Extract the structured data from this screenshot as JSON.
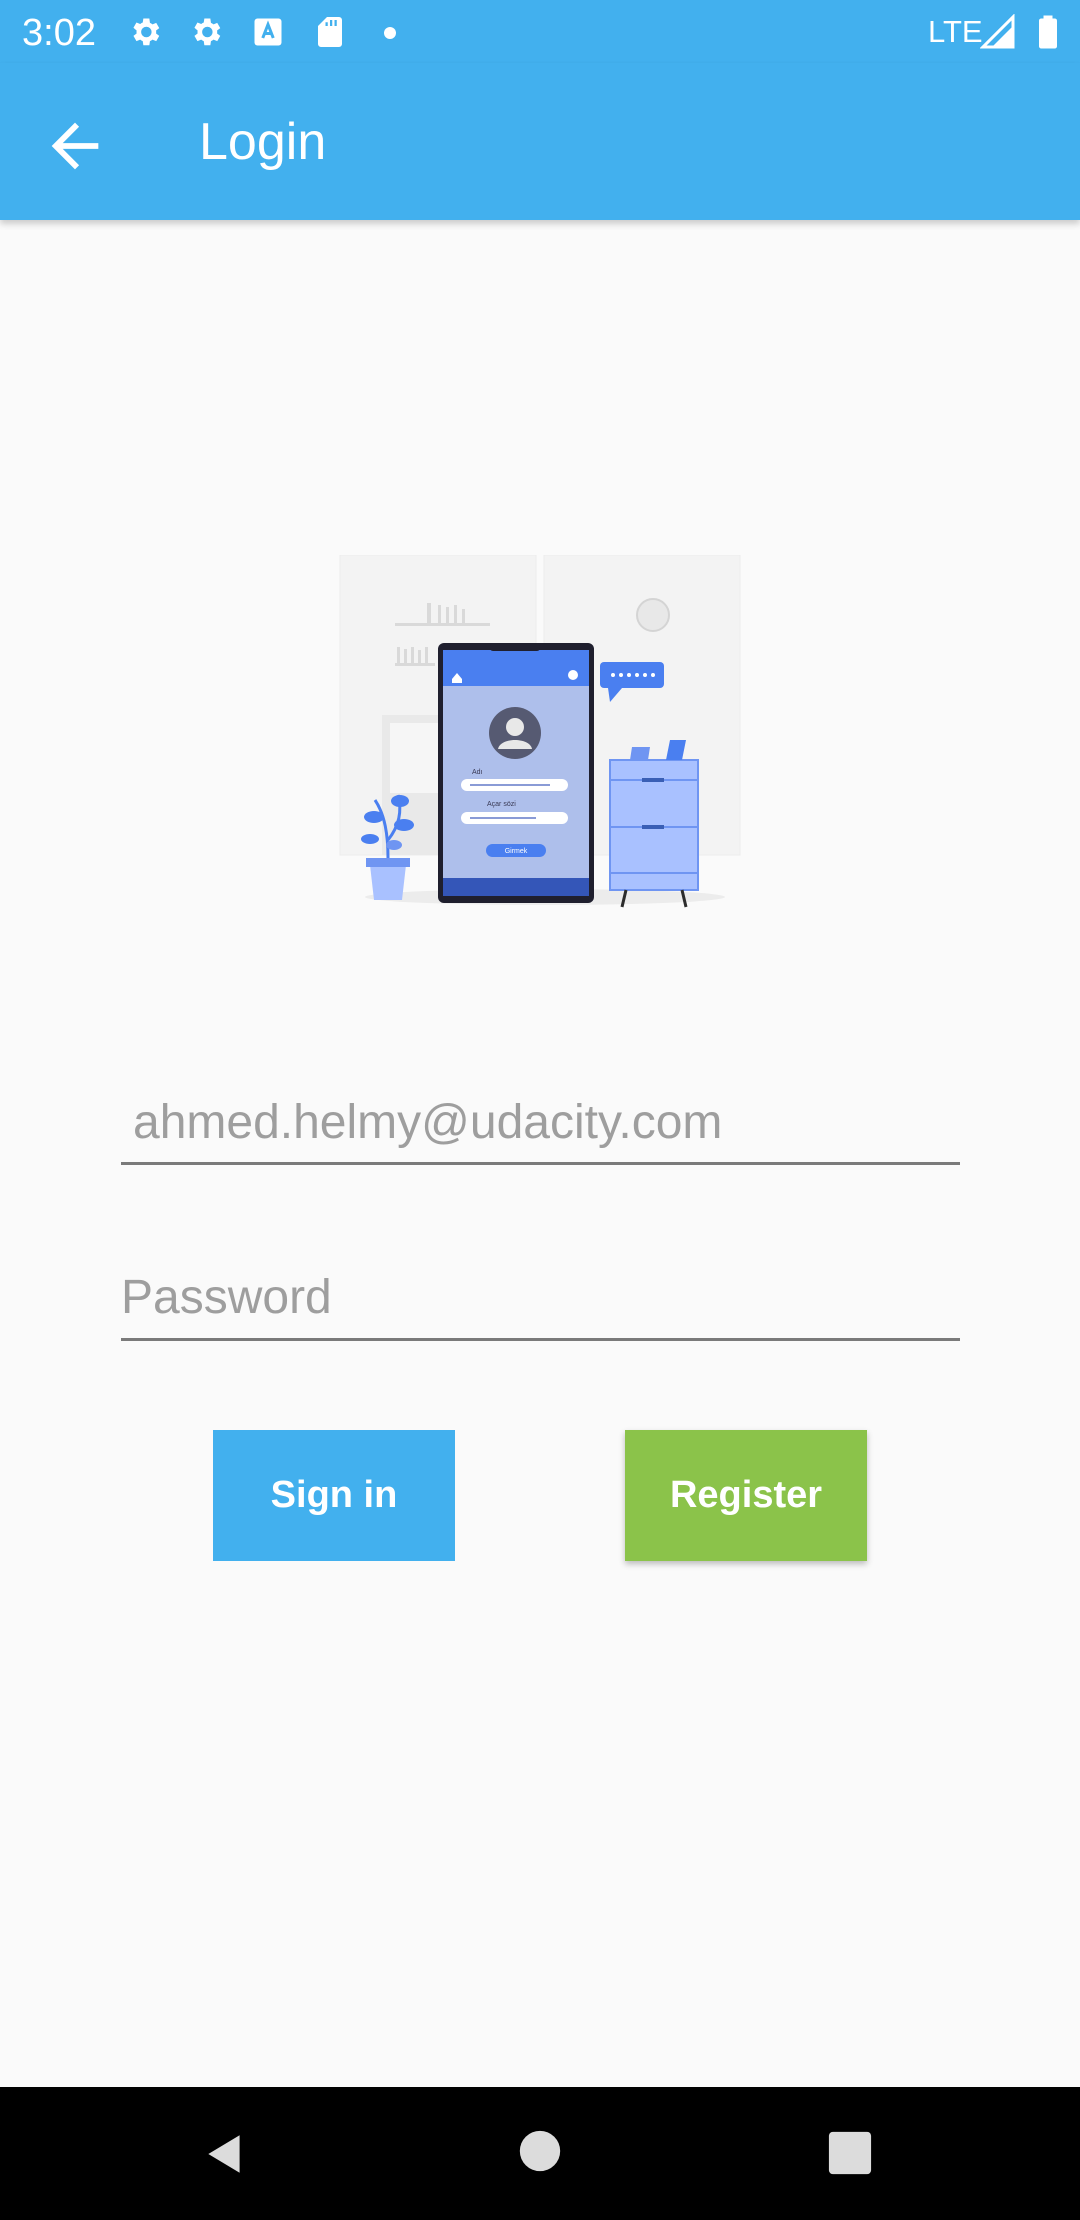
{
  "status_bar": {
    "time": "3:02",
    "network": "LTE",
    "icons": [
      "settings-icon",
      "settings-icon",
      "text-recognition-icon",
      "sd-card-icon",
      "notification-dot-icon",
      "signal-icon",
      "battery-icon"
    ]
  },
  "app_bar": {
    "title": "Login",
    "back_icon": "arrow-back-icon"
  },
  "illustration": {
    "name_label": "Adı",
    "password_label": "Açar sözi",
    "button_label": "Girmek"
  },
  "form": {
    "email_value": "ahmed.helmy@udacity.com",
    "password_placeholder": "Password"
  },
  "buttons": {
    "sign_in": "Sign in",
    "register": "Register"
  },
  "colors": {
    "primary": "#42b0ee",
    "register": "#8bc34a",
    "background": "#fafafa",
    "illustration_accent": "#4a7ff0"
  },
  "nav_bar": {
    "icons": [
      "back-triangle-icon",
      "home-circle-icon",
      "recents-square-icon"
    ]
  }
}
